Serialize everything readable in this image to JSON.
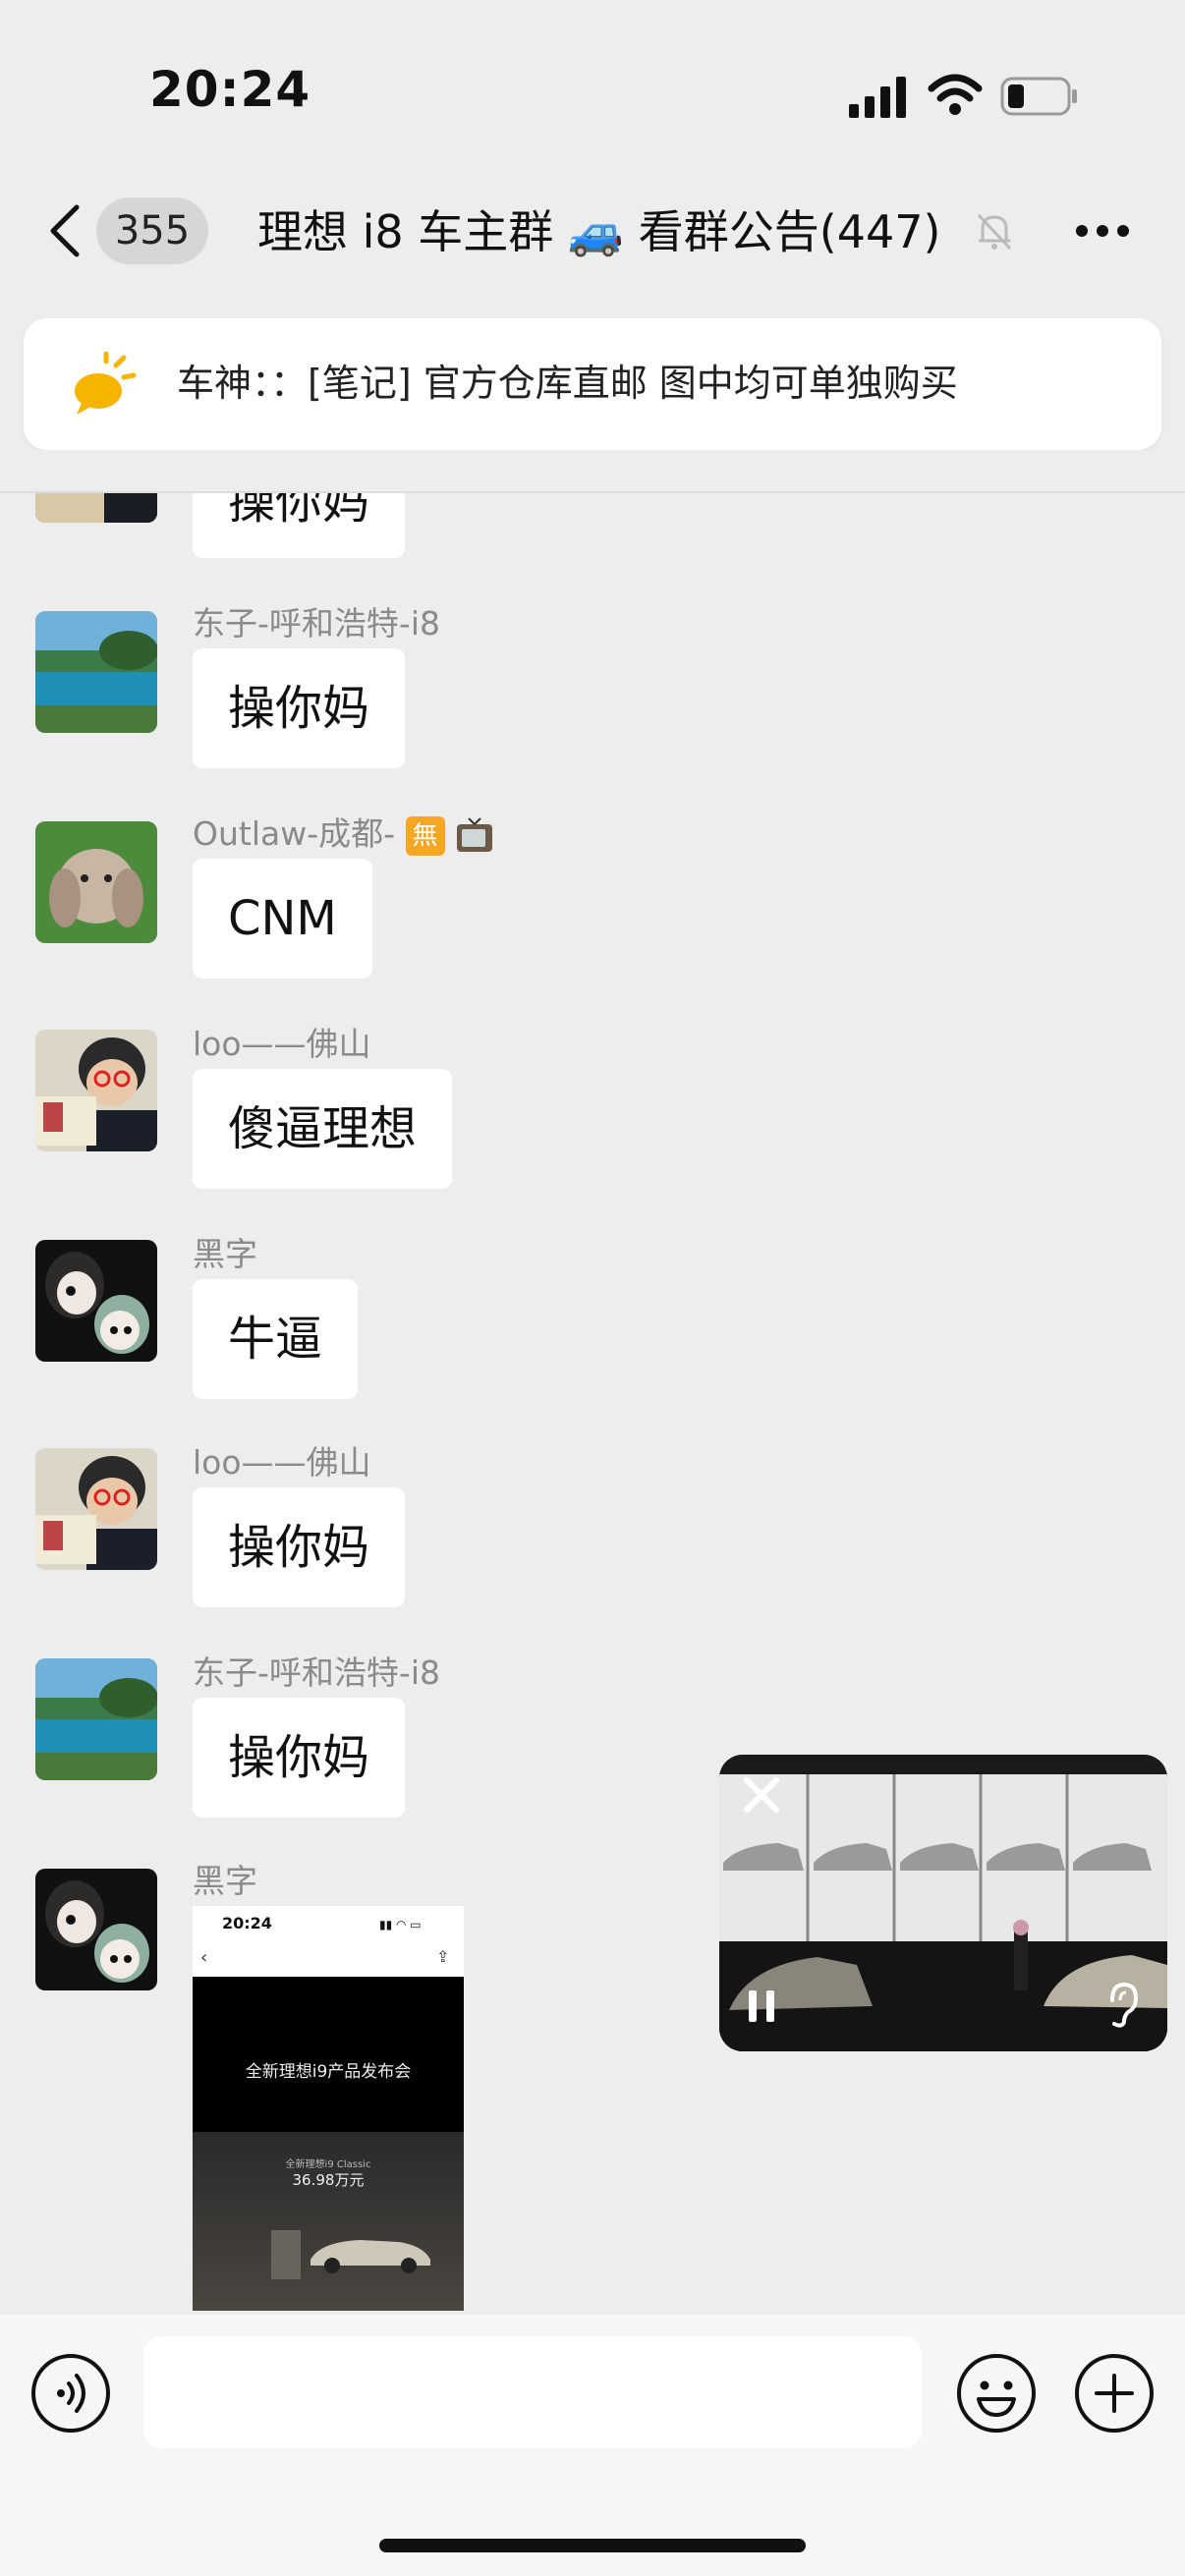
{
  "status_bar": {
    "time": "20:24"
  },
  "header": {
    "unread_count": "355",
    "title": "理想 i8 车主群 🚙 看群公告(447)"
  },
  "notice": {
    "text": "车神：：[笔记] 官方仓库直邮  图中均可单独购买"
  },
  "messages": [
    {
      "sender": "",
      "text": "操你妈"
    },
    {
      "sender": "东子-呼和浩特-i8",
      "text": "操你妈"
    },
    {
      "sender": "Outlaw-成都-",
      "text": "CNM",
      "badges": [
        "無",
        "tv-icon"
      ]
    },
    {
      "sender": "loo——佛山",
      "text": "傻逼理想"
    },
    {
      "sender": "黑字",
      "text": "牛逼"
    },
    {
      "sender": "loo——佛山",
      "text": "操你妈"
    },
    {
      "sender": "东子-呼和浩特-i8",
      "text": "操你妈"
    },
    {
      "sender": "黑字",
      "type": "image"
    }
  ],
  "shared_image": {
    "time": "20:24",
    "title": "全新理想i9产品发布会",
    "caption": "全新理想i9 Classic",
    "price": "36.98万元"
  },
  "input": {
    "placeholder": ""
  },
  "colors": {
    "background": "#ededed",
    "bubble": "#ffffff",
    "sender_gray": "#8a8a8a",
    "badge_orange": "#f5a623"
  },
  "icons": [
    "back-icon",
    "mute-bell-icon",
    "more-icon",
    "bulb-notice-icon",
    "close-icon",
    "pause-icon",
    "ear-icon",
    "voice-icon",
    "emoji-icon",
    "plus-icon"
  ]
}
